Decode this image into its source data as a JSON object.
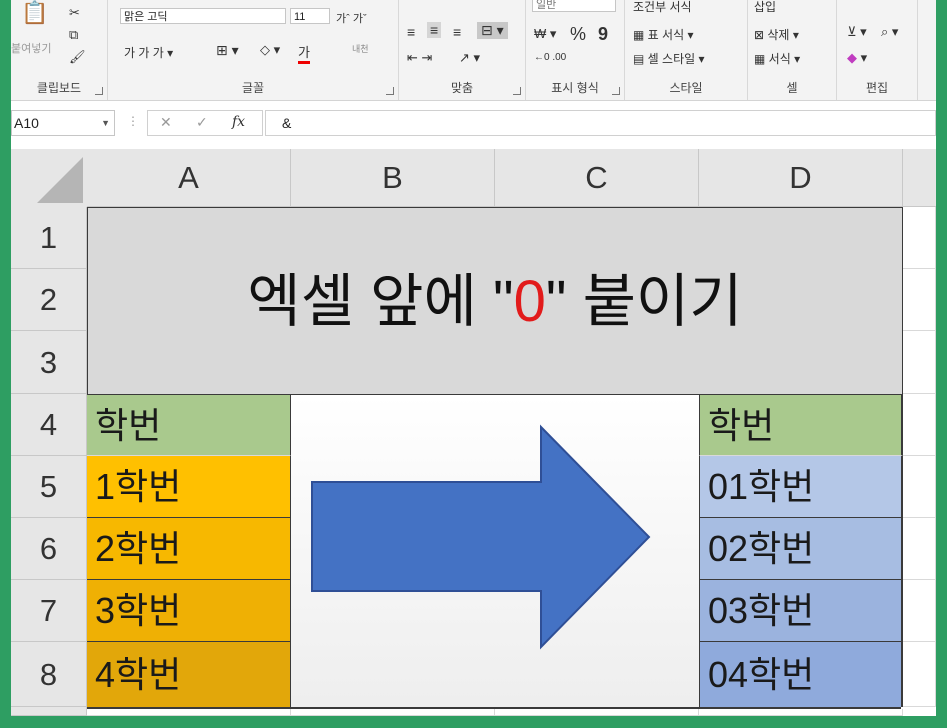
{
  "ribbon": {
    "clipboard": {
      "paste_label": "붙여넣기",
      "group_label": "클립보드"
    },
    "font": {
      "font_name": "맑은 고딕",
      "font_size": "11",
      "group_label": "글꼴"
    },
    "alignment": {
      "group_label": "맞춤"
    },
    "number": {
      "format": "일반",
      "percent": "%",
      "comma": "9",
      "group_label": "표시 형식"
    },
    "styles": {
      "conditional_label": "조건부 서식",
      "table_format_label": "표 서식",
      "cell_style_label": "셀 스타일",
      "group_label": "스타일"
    },
    "cells": {
      "insert_label": "삽입",
      "delete_label": "삭제",
      "format_label": "서식",
      "group_label": "셀"
    },
    "editing": {
      "group_label": "편집"
    }
  },
  "formula_bar": {
    "name_box": "A10",
    "cancel_icon": "✕",
    "enter_icon": "✓",
    "fx_label": "fx",
    "content": "&"
  },
  "columns": [
    "A",
    "B",
    "C",
    "D"
  ],
  "rows": [
    "1",
    "2",
    "3",
    "4",
    "5",
    "6",
    "7",
    "8"
  ],
  "title": {
    "prefix": "엑셀 앞에 \"",
    "zero": "0",
    "suffix": "\" 붙이기"
  },
  "left_table": {
    "header": "학번",
    "cells": [
      "1학번",
      "2학번",
      "3학번",
      "4학번"
    ]
  },
  "right_table": {
    "header": "학번",
    "cells": [
      "01학번",
      "02학번",
      "03학번",
      "04학번"
    ]
  },
  "colors": {
    "header_green": "#a9c98d",
    "left_orange_top": "#ffc000",
    "left_orange_bottom": "#e2a70a",
    "right_blue_top": "#b4c7e7",
    "right_blue_bottom": "#8faadc",
    "arrow_fill": "#4472c4",
    "arrow_stroke": "#2f4f96",
    "title_bg": "#d9d9d9",
    "zero_red": "#e21b1b"
  }
}
